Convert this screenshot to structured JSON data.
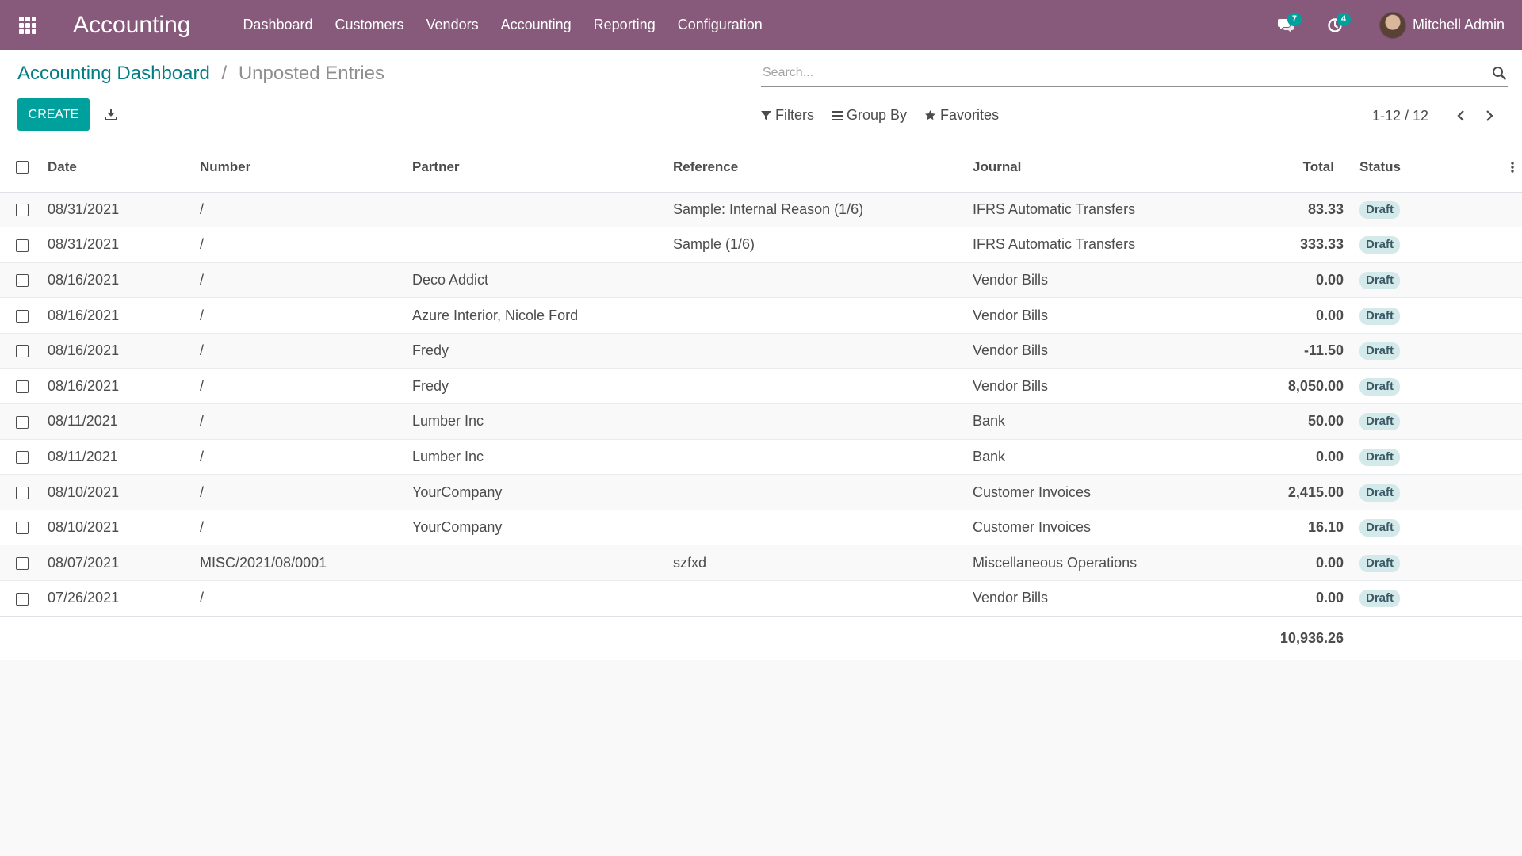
{
  "navbar": {
    "brand": "Accounting",
    "menu": [
      "Dashboard",
      "Customers",
      "Vendors",
      "Accounting",
      "Reporting",
      "Configuration"
    ],
    "messages_count": "7",
    "activities_count": "4",
    "user_name": "Mitchell Admin",
    "accent_color": "#875a7b"
  },
  "breadcrumb": {
    "parent": "Accounting Dashboard",
    "separator": "/",
    "current": "Unposted Entries"
  },
  "search": {
    "placeholder": "Search..."
  },
  "toolbar": {
    "create_label": "CREATE",
    "filters_label": "Filters",
    "group_by_label": "Group By",
    "favorites_label": "Favorites"
  },
  "pager": {
    "value": "1-12 / 12"
  },
  "table": {
    "columns": [
      "Date",
      "Number",
      "Partner",
      "Reference",
      "Journal",
      "Total",
      "Status"
    ],
    "rows": [
      {
        "date": "08/31/2021",
        "number": "/",
        "partner": "",
        "reference": "Sample: Internal Reason (1/6)",
        "journal": "IFRS Automatic Transfers",
        "total": "83.33",
        "status": "Draft"
      },
      {
        "date": "08/31/2021",
        "number": "/",
        "partner": "",
        "reference": "Sample (1/6)",
        "journal": "IFRS Automatic Transfers",
        "total": "333.33",
        "status": "Draft"
      },
      {
        "date": "08/16/2021",
        "number": "/",
        "partner": "Deco Addict",
        "reference": "",
        "journal": "Vendor Bills",
        "total": "0.00",
        "status": "Draft"
      },
      {
        "date": "08/16/2021",
        "number": "/",
        "partner": "Azure Interior, Nicole Ford",
        "reference": "",
        "journal": "Vendor Bills",
        "total": "0.00",
        "status": "Draft"
      },
      {
        "date": "08/16/2021",
        "number": "/",
        "partner": "Fredy",
        "reference": "",
        "journal": "Vendor Bills",
        "total": "-11.50",
        "status": "Draft"
      },
      {
        "date": "08/16/2021",
        "number": "/",
        "partner": "Fredy",
        "reference": "",
        "journal": "Vendor Bills",
        "total": "8,050.00",
        "status": "Draft"
      },
      {
        "date": "08/11/2021",
        "number": "/",
        "partner": "Lumber Inc",
        "reference": "",
        "journal": "Bank",
        "total": "50.00",
        "status": "Draft"
      },
      {
        "date": "08/11/2021",
        "number": "/",
        "partner": "Lumber Inc",
        "reference": "",
        "journal": "Bank",
        "total": "0.00",
        "status": "Draft"
      },
      {
        "date": "08/10/2021",
        "number": "/",
        "partner": "YourCompany",
        "reference": "",
        "journal": "Customer Invoices",
        "total": "2,415.00",
        "status": "Draft"
      },
      {
        "date": "08/10/2021",
        "number": "/",
        "partner": "YourCompany",
        "reference": "",
        "journal": "Customer Invoices",
        "total": "16.10",
        "status": "Draft"
      },
      {
        "date": "08/07/2021",
        "number": "MISC/2021/08/0001",
        "partner": "",
        "reference": "szfxd",
        "journal": "Miscellaneous Operations",
        "total": "0.00",
        "status": "Draft"
      },
      {
        "date": "07/26/2021",
        "number": "/",
        "partner": "",
        "reference": "",
        "journal": "Vendor Bills",
        "total": "0.00",
        "status": "Draft"
      }
    ],
    "grand_total": "10,936.26"
  }
}
